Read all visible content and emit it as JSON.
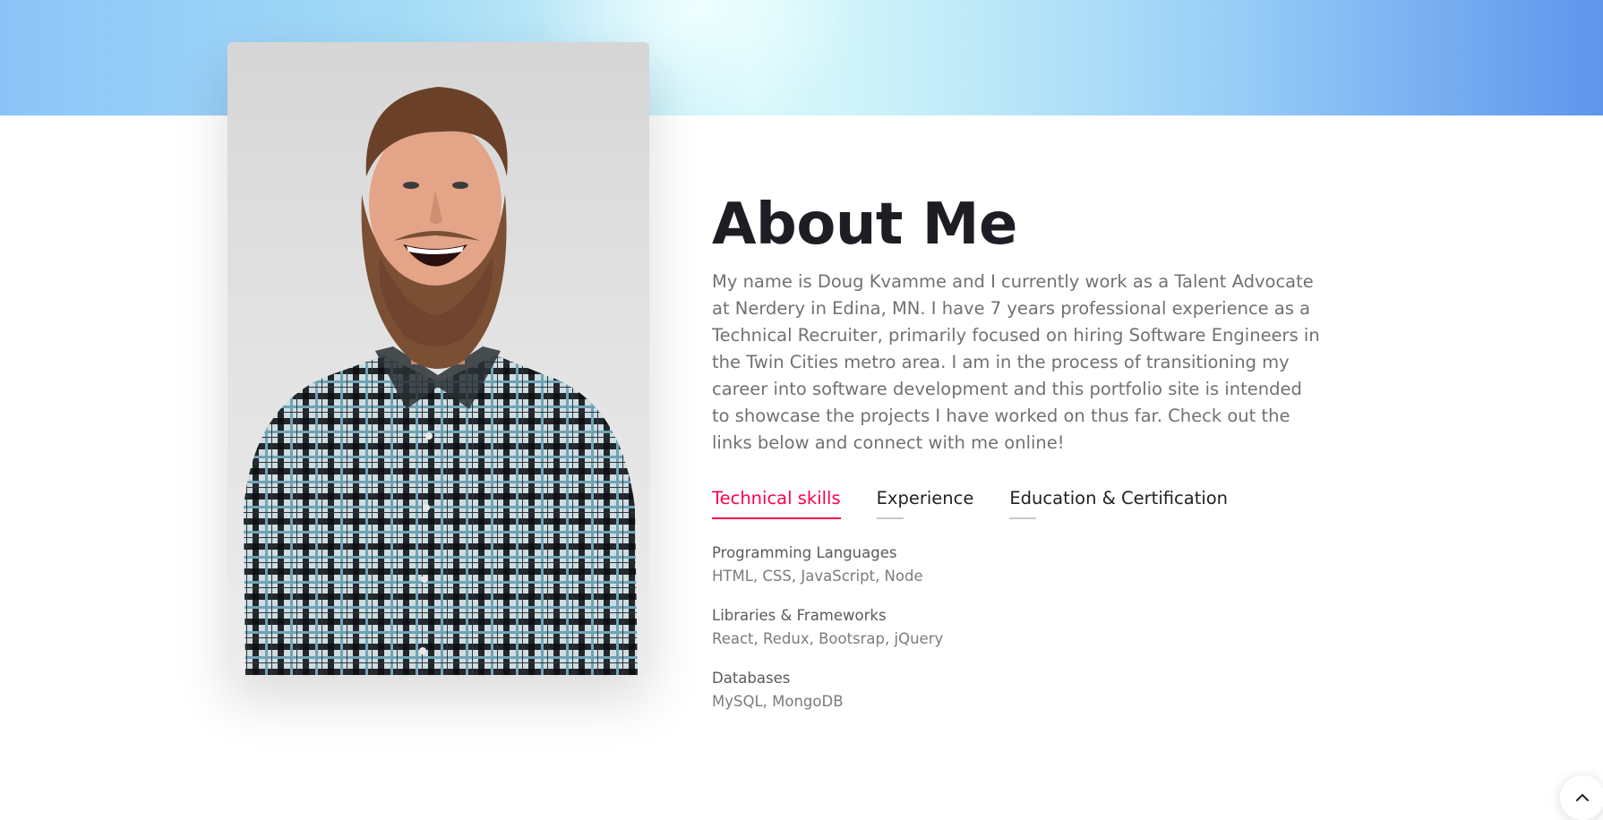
{
  "about": {
    "title": "About Me",
    "text": "My name is Doug Kvamme and I currently work as a Talent Advocate at Nerdery in Edina, MN. I have 7 years professional experience as a Technical Recruiter, primarily focused on hiring Software Engineers in the Twin Cities metro area. I am in the process of transitioning my career into software development and this portfolio site is intended to showcase the projects I have worked on thus far. Check out the links below and connect with me online!"
  },
  "tabs": [
    {
      "label": "Technical skills",
      "active": true
    },
    {
      "label": "Experience",
      "active": false
    },
    {
      "label": "Education & Certification",
      "active": false
    }
  ],
  "skills": [
    {
      "name": "Programming Languages",
      "value": "HTML, CSS, JavaScript, Node"
    },
    {
      "name": "Libraries & Frameworks",
      "value": "React, Redux, Bootsrap, jQuery"
    },
    {
      "name": "Databases",
      "value": "MySQL, MongoDB"
    }
  ],
  "icons": {
    "scroll_top": "chevron-up-icon"
  },
  "colors": {
    "accent": "#f9004d",
    "heading": "#1d1d24",
    "body_text": "#717173",
    "banner_start": "#8cc4f8",
    "banner_end": "#5f95ec"
  }
}
